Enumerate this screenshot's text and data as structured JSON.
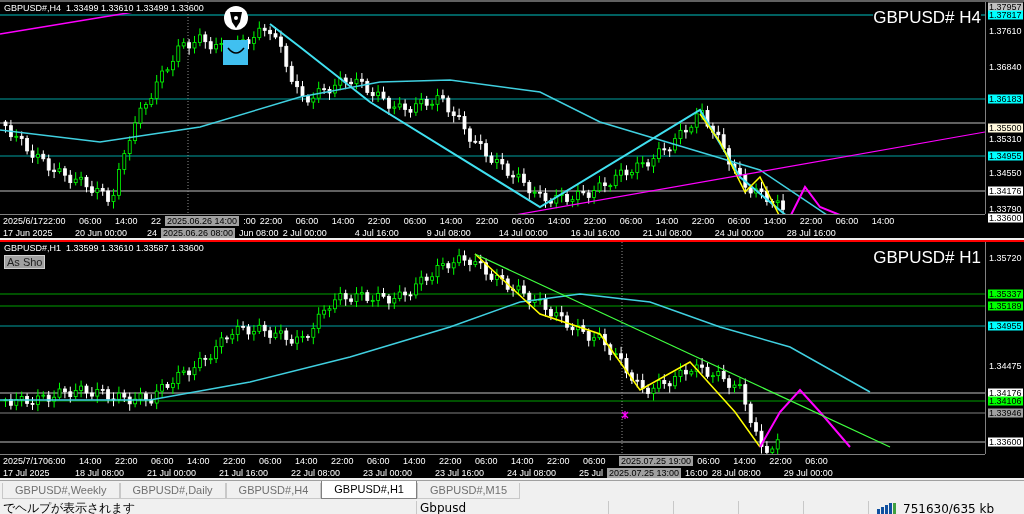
{
  "charts": [
    {
      "header": "GBPUSD#,H4  1.33499 1.33610 1.33499 1.33600",
      "title": "GBPUSD# H4",
      "active": false,
      "price_labels": [
        {
          "text": "1.37957",
          "kind": "tag",
          "color": "#c0c0c0"
        },
        {
          "text": "1.37817",
          "kind": "tag",
          "color": "#00ffff"
        },
        {
          "text": "1.37610",
          "kind": "tick"
        },
        {
          "text": "1.36840",
          "kind": "tick"
        },
        {
          "text": "1.36183",
          "kind": "tag",
          "color": "#00ffff"
        },
        {
          "text": "1.35500",
          "kind": "tag",
          "color": "#fff8dc"
        },
        {
          "text": "1.35310",
          "kind": "tick"
        },
        {
          "text": "1.34955",
          "kind": "tag",
          "color": "#00ffff"
        },
        {
          "text": "1.34550",
          "kind": "tick"
        },
        {
          "text": "1.34176",
          "kind": "tag",
          "color": "#ffffff"
        },
        {
          "text": "1.33790",
          "kind": "tick"
        },
        {
          "text": "1.33600",
          "kind": "tag",
          "color": "#ffffff"
        }
      ],
      "time_row_1": [
        {
          "text": "2025/6/17",
          "kind": "tick"
        },
        {
          "text": "22:00",
          "kind": "tick"
        },
        {
          "text": "06:00",
          "kind": "tick"
        },
        {
          "text": "14:00",
          "kind": "tick"
        },
        {
          "text": "22",
          "kind": "part"
        },
        {
          "text": "2025.06.26 14:00",
          "kind": "cursor"
        },
        {
          "text": ":00",
          "kind": "part"
        },
        {
          "text": "22:00",
          "kind": "tick"
        },
        {
          "text": "06:00",
          "kind": "tick"
        },
        {
          "text": "14:00",
          "kind": "tick"
        },
        {
          "text": "22:00",
          "kind": "tick"
        },
        {
          "text": "06:00",
          "kind": "tick"
        },
        {
          "text": "14:00",
          "kind": "tick"
        },
        {
          "text": "22:00",
          "kind": "tick"
        },
        {
          "text": "06:00",
          "kind": "tick"
        },
        {
          "text": "14:00",
          "kind": "tick"
        },
        {
          "text": "22:00",
          "kind": "tick"
        },
        {
          "text": "06:00",
          "kind": "tick"
        },
        {
          "text": "14:00",
          "kind": "tick"
        },
        {
          "text": "22:00",
          "kind": "tick"
        },
        {
          "text": "06:00",
          "kind": "tick"
        },
        {
          "text": "14:00",
          "kind": "tick"
        },
        {
          "text": "22:00",
          "kind": "tick"
        },
        {
          "text": "06:00",
          "kind": "tick"
        },
        {
          "text": "14:00",
          "kind": "tick"
        }
      ],
      "time_row_2": [
        {
          "text": "17 Jun 2025",
          "kind": "wide"
        },
        {
          "text": "20 Jun 00:00",
          "kind": "wide"
        },
        {
          "text": "24",
          "kind": "part"
        },
        {
          "text": "2025.06.26 08:00",
          "kind": "cursor"
        },
        {
          "text": "Jun 08:00",
          "kind": "part"
        },
        {
          "text": "2 Jul 00:00",
          "kind": "wide"
        },
        {
          "text": "4 Jul 16:00",
          "kind": "wide"
        },
        {
          "text": "9 Jul 08:00",
          "kind": "wide"
        },
        {
          "text": "14 Jul 00:00",
          "kind": "wide"
        },
        {
          "text": "16 Jul 16:00",
          "kind": "wide"
        },
        {
          "text": "21 Jul 08:00",
          "kind": "wide"
        },
        {
          "text": "24 Jul 00:00",
          "kind": "wide"
        },
        {
          "text": "28 Jul 16:00",
          "kind": "wide"
        }
      ]
    },
    {
      "header": "GBPUSD#,H1  1.33599 1.33610 1.33587 1.33600",
      "title": "GBPUSD# H1",
      "active": true,
      "button": "As Sho",
      "price_labels": [
        {
          "text": "1.35720",
          "kind": "tick"
        },
        {
          "text": "1.35337",
          "kind": "tag",
          "color": "#00ff00"
        },
        {
          "text": "1.35189",
          "kind": "tag",
          "color": "#00ff00"
        },
        {
          "text": "1.34955",
          "kind": "tag",
          "color": "#00ffff"
        },
        {
          "text": "1.34475",
          "kind": "tick"
        },
        {
          "text": "1.34176",
          "kind": "tag",
          "color": "#ffffff"
        },
        {
          "text": "1.34106",
          "kind": "tag",
          "color": "#00ff00"
        },
        {
          "text": "1.33946",
          "kind": "tag",
          "color": "#a0a0a0"
        },
        {
          "text": "1.33600",
          "kind": "tag",
          "color": "#ffffff"
        }
      ],
      "time_row_1": [
        {
          "text": "2025/7/17",
          "kind": "tick"
        },
        {
          "text": "06:00",
          "kind": "tick"
        },
        {
          "text": "14:00",
          "kind": "tick"
        },
        {
          "text": "22:00",
          "kind": "tick"
        },
        {
          "text": "06:00",
          "kind": "tick"
        },
        {
          "text": "14:00",
          "kind": "tick"
        },
        {
          "text": "22:00",
          "kind": "tick"
        },
        {
          "text": "06:00",
          "kind": "tick"
        },
        {
          "text": "14:00",
          "kind": "tick"
        },
        {
          "text": "22:00",
          "kind": "tick"
        },
        {
          "text": "06:00",
          "kind": "tick"
        },
        {
          "text": "14:00",
          "kind": "tick"
        },
        {
          "text": "22:00",
          "kind": "tick"
        },
        {
          "text": "06:00",
          "kind": "tick"
        },
        {
          "text": "14:00",
          "kind": "tick"
        },
        {
          "text": "22:00",
          "kind": "tick"
        },
        {
          "text": "06:00",
          "kind": "tick"
        },
        {
          "text": "2025.07.25 19:00",
          "kind": "cursor"
        },
        {
          "text": "06:00",
          "kind": "tick"
        },
        {
          "text": "14:00",
          "kind": "tick"
        },
        {
          "text": "22:00",
          "kind": "tick"
        },
        {
          "text": "06:00",
          "kind": "tick"
        }
      ],
      "time_row_2": [
        {
          "text": "17 Jul 2025",
          "kind": "wide"
        },
        {
          "text": "18 Jul 08:00",
          "kind": "wide"
        },
        {
          "text": "21 Jul 00:00",
          "kind": "wide"
        },
        {
          "text": "21 Jul 16:00",
          "kind": "wide"
        },
        {
          "text": "22 Jul 08:00",
          "kind": "wide"
        },
        {
          "text": "23 Jul 00:00",
          "kind": "wide"
        },
        {
          "text": "23 Jul 16:00",
          "kind": "wide"
        },
        {
          "text": "24 Jul 08:00",
          "kind": "wide"
        },
        {
          "text": "25 Jul",
          "kind": "part"
        },
        {
          "text": "2025.07.25 13:00",
          "kind": "cursor"
        },
        {
          "text": "16:00",
          "kind": "part"
        },
        {
          "text": "28 Jul 08:00",
          "kind": "wide"
        },
        {
          "text": "29 Jul 00:00",
          "kind": "wide"
        }
      ]
    }
  ],
  "tabs": [
    {
      "label": "GBPUSD#,Weekly",
      "selected": false
    },
    {
      "label": "GBPUSD#,Daily",
      "selected": false
    },
    {
      "label": "GBPUSD#,H4",
      "selected": false
    },
    {
      "label": "GBPUSD#,H1",
      "selected": true
    },
    {
      "label": "GBPUSD#,M15",
      "selected": false
    }
  ],
  "status_bar": {
    "help": "でヘルプが表示されます",
    "profile": "Gbpusd",
    "traffic": "751630/635 kb"
  }
}
